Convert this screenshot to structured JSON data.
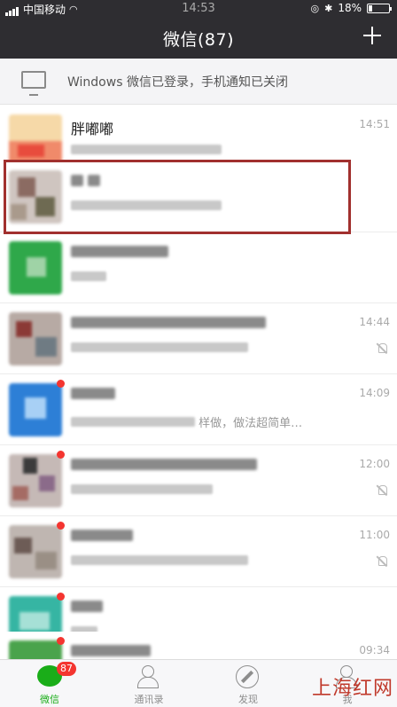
{
  "status_bar": {
    "carrier": "中国移动",
    "time": "14:53",
    "battery": "18%"
  },
  "nav": {
    "title": "微信(87)",
    "add_icon": "plus-icon"
  },
  "banner": {
    "icon": "monitor-icon",
    "text": "Windows 微信已登录，手机通知已关闭"
  },
  "chats": [
    {
      "name": "胖嘟嘟",
      "preview": "",
      "time": "14:51",
      "muted": false,
      "unread": false
    },
    {
      "name": "",
      "preview": "",
      "time": "",
      "muted": false,
      "unread": false
    },
    {
      "name": "",
      "preview": "",
      "time": "",
      "muted": false,
      "unread": false
    },
    {
      "name": "",
      "preview": "",
      "time": "14:44",
      "muted": true,
      "unread": false
    },
    {
      "name": "",
      "preview": "样做，做法超简单…",
      "time": "14:09",
      "muted": false,
      "unread": true
    },
    {
      "name": "",
      "preview": "",
      "time": "12:00",
      "muted": true,
      "unread": true
    },
    {
      "name": "",
      "preview": "",
      "time": "11:00",
      "muted": true,
      "unread": true
    },
    {
      "name": "",
      "preview": "",
      "time": "",
      "muted": false,
      "unread": true
    },
    {
      "name": "",
      "preview": "",
      "time": "09:34",
      "muted": false,
      "unread": true
    }
  ],
  "tabs": [
    {
      "label": "微信",
      "icon": "chat-bubble-icon",
      "badge": "87",
      "active": true
    },
    {
      "label": "通讯录",
      "icon": "contacts-icon",
      "active": false
    },
    {
      "label": "发现",
      "icon": "compass-icon",
      "active": false
    },
    {
      "label": "我",
      "icon": "person-icon",
      "active": false
    }
  ],
  "watermark": "上海红网",
  "colors": {
    "topbar": "#2e2d31",
    "accent_green": "#1aad19",
    "unread_red": "#f43530",
    "highlight_box": "#a1302e"
  }
}
